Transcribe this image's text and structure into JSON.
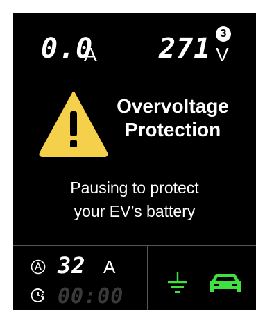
{
  "readout": {
    "current_value": "0.0",
    "current_unit": "A",
    "voltage_value": "271",
    "voltage_unit": "V",
    "phase_badge": "3"
  },
  "alert": {
    "icon": "warning-triangle-icon",
    "title_line1": "Overvoltage",
    "title_line2": "Protection",
    "message_line1": "Pausing to protect",
    "message_line2": "your EV’s battery"
  },
  "status": {
    "current_limit_value": "32",
    "current_limit_unit": "A",
    "timer_value": "00:00",
    "icons": [
      "ampere-icon",
      "clock-charge-icon",
      "ground-icon",
      "car-icon"
    ]
  },
  "colors": {
    "background": "#000000",
    "text": "#ffffff",
    "warning": "#f5d04a",
    "status_ok": "#3fe03f",
    "dim_segment": "#3a3a3a"
  }
}
